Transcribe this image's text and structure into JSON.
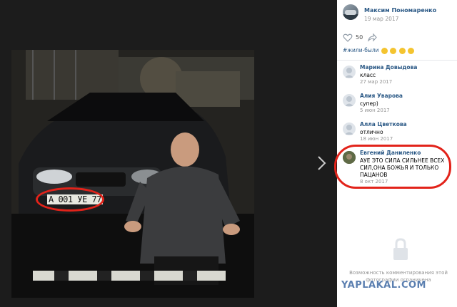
{
  "post": {
    "author": "Максим Пономаренко",
    "date": "19 мар 2017",
    "likes": "50",
    "caption": "#жили-были"
  },
  "photo": {
    "plate_text": "А 001 УЕ 77"
  },
  "comments": [
    {
      "name": "Марина Довыдова",
      "text": "класс",
      "date": "27 мар 2017"
    },
    {
      "name": "Алия Уварова",
      "text": "супер)",
      "date": "5 июн 2017"
    },
    {
      "name": "Алла Цветкова",
      "text": "отлично",
      "date": "18 июн 2017"
    },
    {
      "name": "Евгений Даниленко",
      "text": "АУЕ ЭТО СИЛА СИЛЬНЕЕ ВСЕХ СИЛ,ОНА БОЖЬЯ И ТОЛЬКО ПАЦАНОВ",
      "date": "8 окт 2017"
    }
  ],
  "comments_closed_text": "Возможность комментирования этой фотографии ограничена",
  "watermark": "YAPLAKAL.COM",
  "icons": {
    "like": "heart-icon",
    "share": "share-icon",
    "next": "chevron-right-icon",
    "lock": "lock-icon"
  },
  "colors": {
    "link": "#2a5885",
    "highlight": "#e2231a",
    "muted": "#939393"
  }
}
